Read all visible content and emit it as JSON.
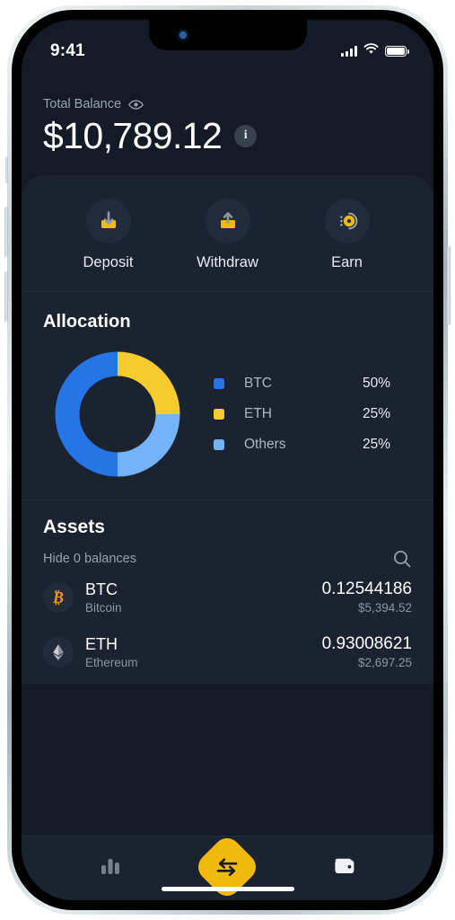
{
  "status_bar": {
    "time": "9:41",
    "signal_icon": "cellular-signal-icon",
    "wifi_icon": "wifi-icon",
    "battery_icon": "battery-icon"
  },
  "balance": {
    "label": "Total Balance",
    "eye_icon": "eye-icon",
    "amount": "$10,789.12",
    "info_icon": "i"
  },
  "quick_actions": [
    {
      "label": "Deposit",
      "icon": "deposit-icon"
    },
    {
      "label": "Withdraw",
      "icon": "withdraw-icon"
    },
    {
      "label": "Earn",
      "icon": "earn-icon"
    }
  ],
  "allocation": {
    "title": "Allocation"
  },
  "chart_data": {
    "type": "pie",
    "title": "Allocation",
    "categories": [
      "BTC",
      "ETH",
      "Others"
    ],
    "values": [
      50,
      25,
      25
    ],
    "labels": [
      "50%",
      "25%",
      "25%"
    ],
    "colors": [
      "#2575e6",
      "#f5cb2e",
      "#72b4f7"
    ],
    "legend_position": "right",
    "donut": true,
    "units": "percent"
  },
  "assets": {
    "title": "Assets",
    "hide_balances_label": "Hide 0 balances",
    "search_icon": "search-icon",
    "rows": [
      {
        "symbol": "BTC",
        "name": "Bitcoin",
        "amount": "0.12544186",
        "fiat": "$5,394.52",
        "logo": "bitcoin-icon",
        "logo_color": "#f7931a"
      },
      {
        "symbol": "ETH",
        "name": "Ethereum",
        "amount": "0.93008621",
        "fiat": "$2,697.25",
        "logo": "ethereum-icon",
        "logo_color": "#c9ccd4"
      }
    ]
  },
  "bottom_nav": [
    {
      "name": "markets",
      "icon": "bar-chart-icon",
      "active": false
    },
    {
      "name": "swap",
      "icon": "swap-arrows-icon",
      "active": true
    },
    {
      "name": "wallet",
      "icon": "wallet-icon",
      "active": false
    }
  ],
  "theme": {
    "background": "#151b26",
    "panel": "#1b2230",
    "accent": "#f0b90b",
    "text_primary": "#ffffff",
    "text_muted": "#8d97a5"
  }
}
